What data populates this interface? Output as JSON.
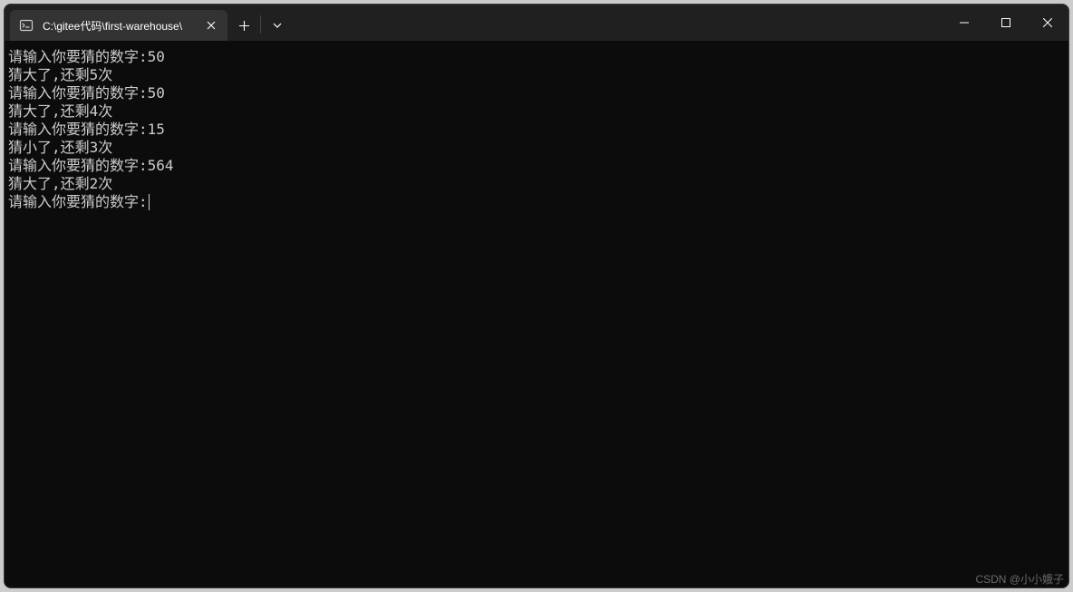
{
  "tab": {
    "title": "C:\\gitee代码\\first-warehouse\\"
  },
  "terminal": {
    "lines": [
      "请输入你要猜的数字:50",
      "猜大了,还剩5次",
      "请输入你要猜的数字:50",
      "猜大了,还剩4次",
      "请输入你要猜的数字:15",
      "猜小了,还剩3次",
      "请输入你要猜的数字:564",
      "猜大了,还剩2次"
    ],
    "prompt": "请输入你要猜的数字:"
  },
  "watermark": "CSDN @小小娥子"
}
